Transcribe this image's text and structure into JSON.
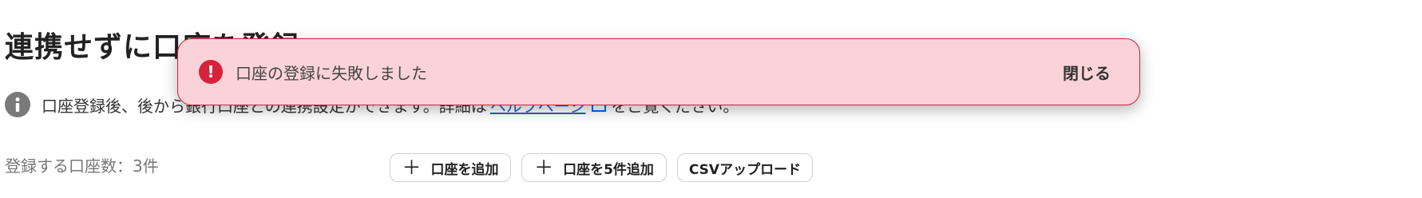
{
  "page": {
    "title": "連携せずに口座を登録"
  },
  "info": {
    "text_before_link": "口座登録後、後から銀行口座との連携設定ができます。詳細は",
    "link_label": "ヘルプページ",
    "text_after_link": "をご覧ください。"
  },
  "accounts": {
    "count_label": "登録する口座数：3件"
  },
  "actions": {
    "add_label": "口座を追加",
    "add5_label": "口座を5件追加",
    "csv_label": "CSVアップロード"
  },
  "toast": {
    "message": "口座の登録に失敗しました",
    "close_label": "閉じる",
    "icon": "exclamation-icon",
    "accent_color": "#d8213a"
  }
}
